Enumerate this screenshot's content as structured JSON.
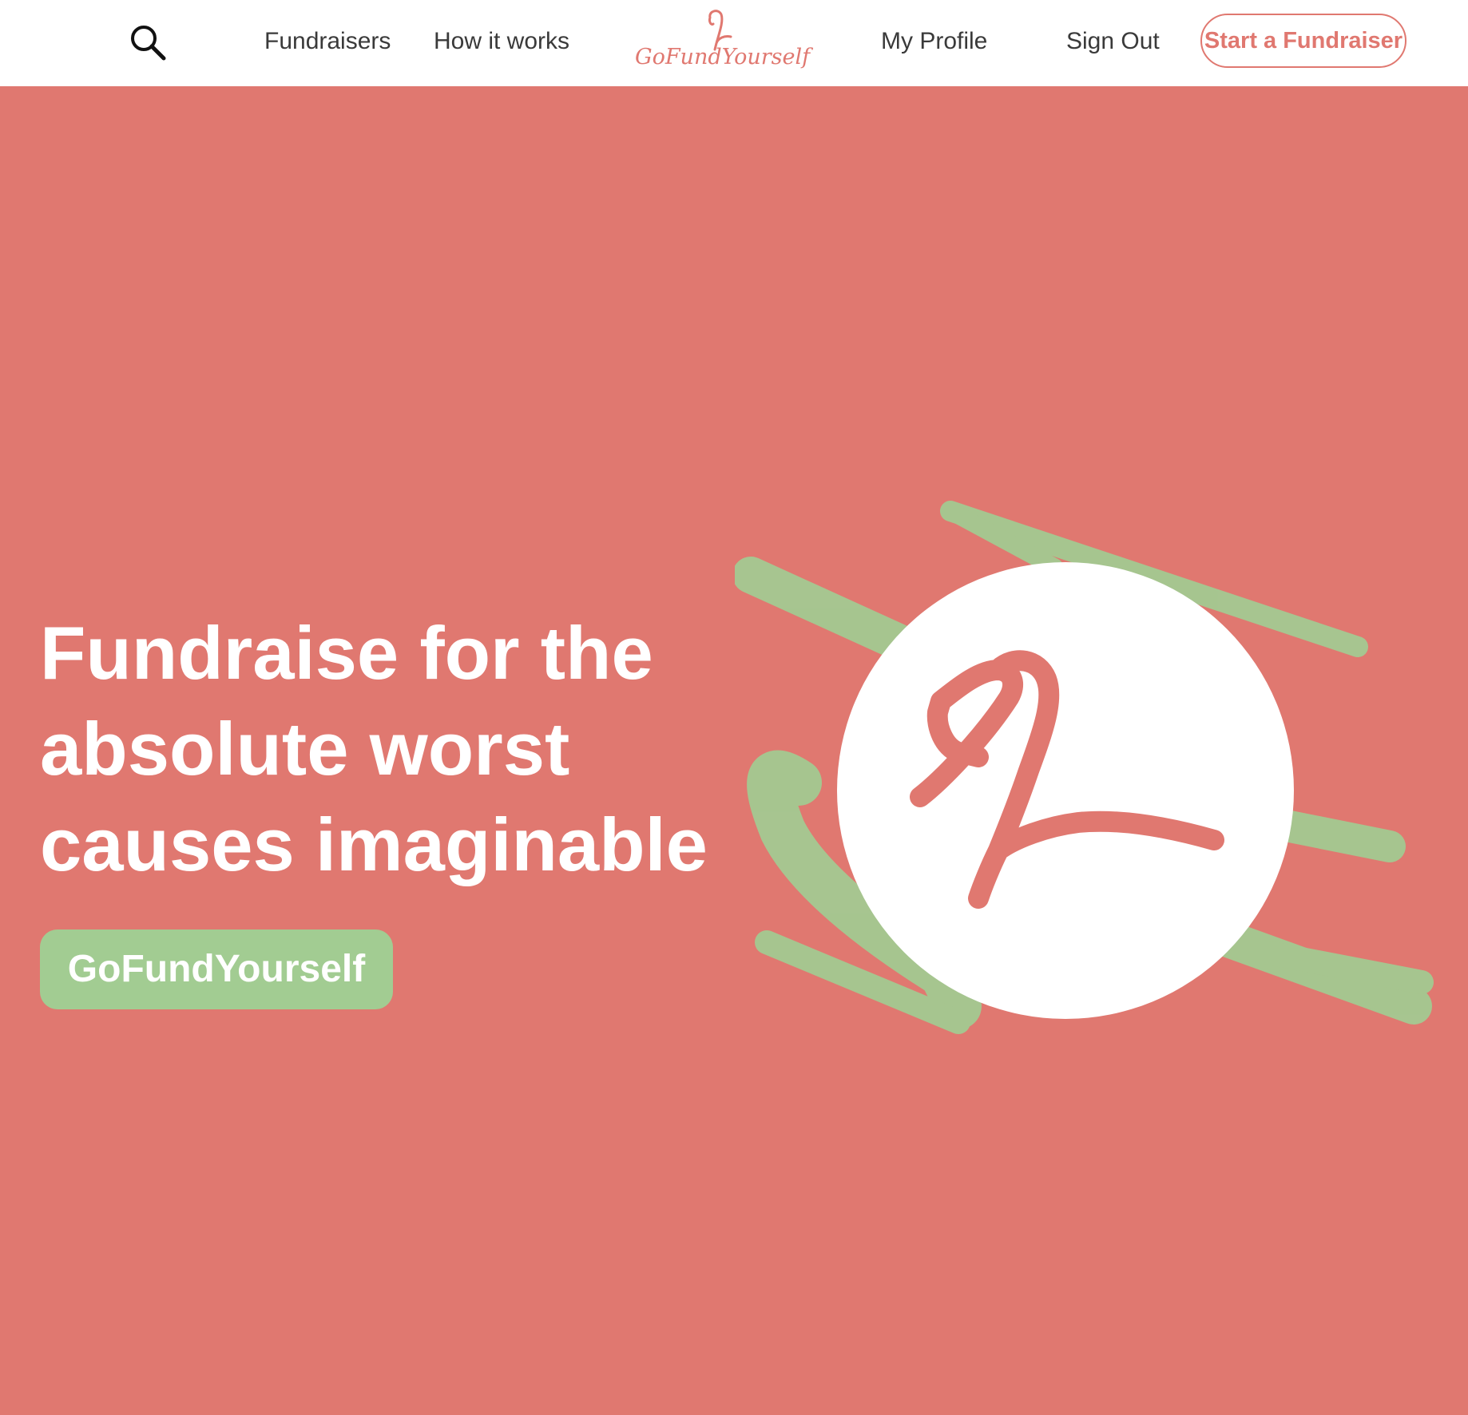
{
  "brand": {
    "name": "GoFundYourself",
    "colors": {
      "primary": "#e07870",
      "accent_green": "#a2cc92",
      "nav_background": "#ffffff",
      "nav_text": "#3a3a3a",
      "hero_text": "#ffffff"
    }
  },
  "nav": {
    "search_icon": "search-icon",
    "links": {
      "fundraisers": "Fundraisers",
      "how_it_works": "How it works",
      "my_profile": "My Profile",
      "sign_out": "Sign Out"
    },
    "logo_text": "GoFundYourself",
    "cta_label": "Start a Fundraiser"
  },
  "hero": {
    "title_lines": [
      "Fundraise for the",
      "absolute worst",
      "causes imaginable"
    ],
    "cta_label": "GoFundYourself",
    "illustration_icon": "flamingo-logo-icon"
  }
}
